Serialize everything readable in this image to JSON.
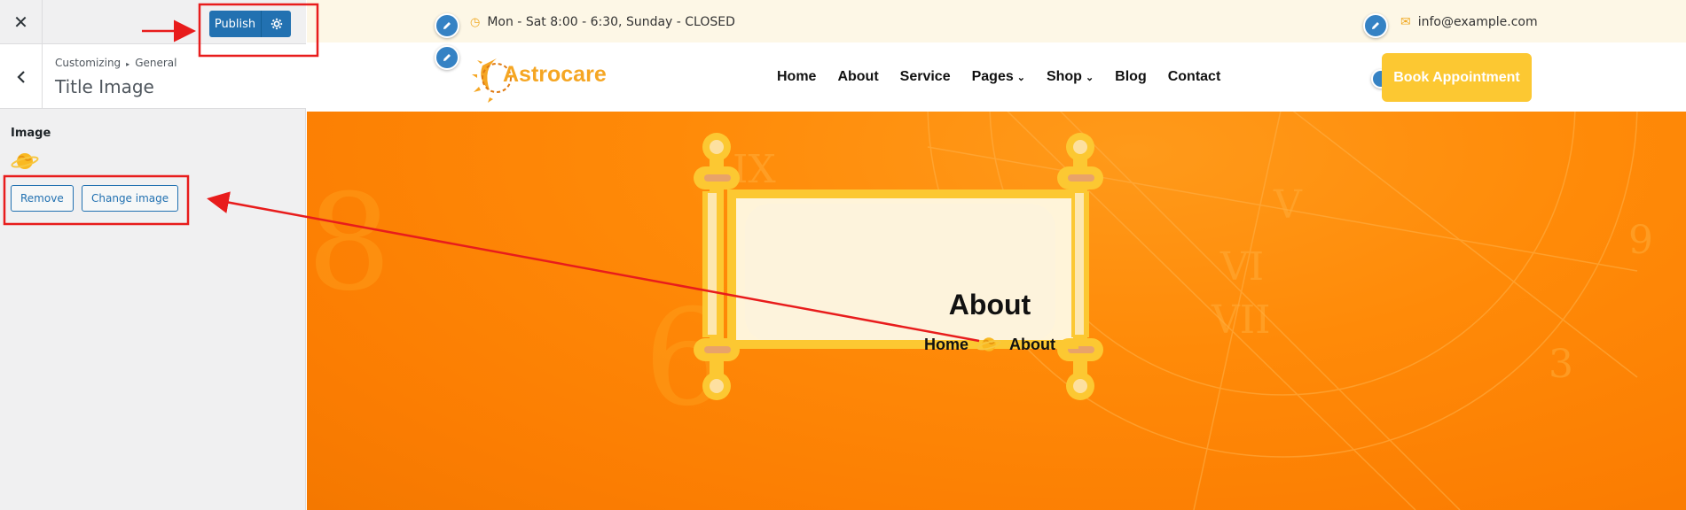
{
  "customizer": {
    "close_icon": "close-icon",
    "publish_label": "Publish",
    "publish_settings_icon": "gear-icon",
    "back_icon": "chevron-left-icon",
    "breadcrumb": [
      "Customizing",
      "General"
    ],
    "section_title": "Title Image",
    "image_label": "Image",
    "remove_label": "Remove",
    "change_label": "Change image"
  },
  "site": {
    "hours": "Mon - Sat 8:00 - 6:30, Sunday - CLOSED",
    "email": "info@example.com",
    "logo_text": "Astrocare",
    "menu": [
      {
        "label": "Home"
      },
      {
        "label": "About"
      },
      {
        "label": "Service"
      },
      {
        "label": "Pages",
        "has_dropdown": true
      },
      {
        "label": "Shop",
        "has_dropdown": true
      },
      {
        "label": "Blog"
      },
      {
        "label": "Contact"
      }
    ],
    "book_label": "Book Appointment",
    "hero_title": "About",
    "hero_crumb_home": "Home",
    "hero_crumb_current": "About"
  },
  "colors": {
    "wp_blue": "#2271b1",
    "accent_yellow": "#fcc832",
    "hero_orange": "#ff8a08",
    "annotation_red": "#e81c1c"
  }
}
